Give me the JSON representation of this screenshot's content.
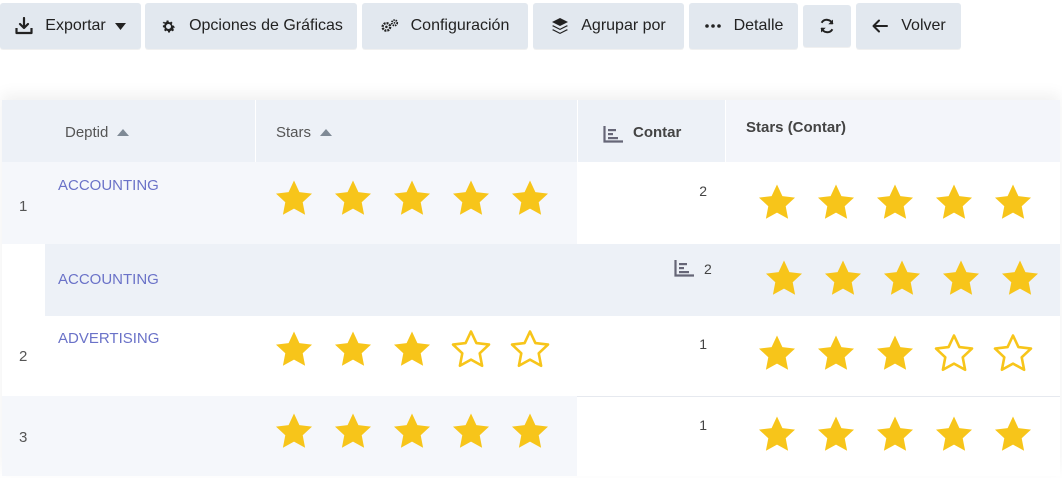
{
  "toolbar": {
    "export_label": "Exportar",
    "chart_options_label": "Opciones de Gráficas",
    "settings_label": "Configuración",
    "group_by_label": "Agrupar por",
    "detail_label": "Detalle",
    "back_label": "Volver"
  },
  "table": {
    "headers": {
      "deptid": "Deptid",
      "stars": "Stars",
      "count": "Contar",
      "stars_count": "Stars (Contar)"
    },
    "rows": [
      {
        "row_number": "1",
        "dept": "ACCOUNTING",
        "stars": 5,
        "count": "2",
        "stars_count": 5
      },
      {
        "row_number": "",
        "dept": "ACCOUNTING",
        "subtotal": true,
        "count": "2",
        "stars_count": 5
      },
      {
        "row_number": "2",
        "dept": "ADVERTISING",
        "stars": 3,
        "count": "1",
        "stars_count": 3
      },
      {
        "row_number": "3",
        "dept": "",
        "stars": 5,
        "count": "1",
        "stars_count": 5
      }
    ],
    "max_stars": 5
  },
  "colors": {
    "star_fill": "#f7c51a",
    "link": "#6a72c8",
    "button_bg": "#e2e8ef"
  }
}
